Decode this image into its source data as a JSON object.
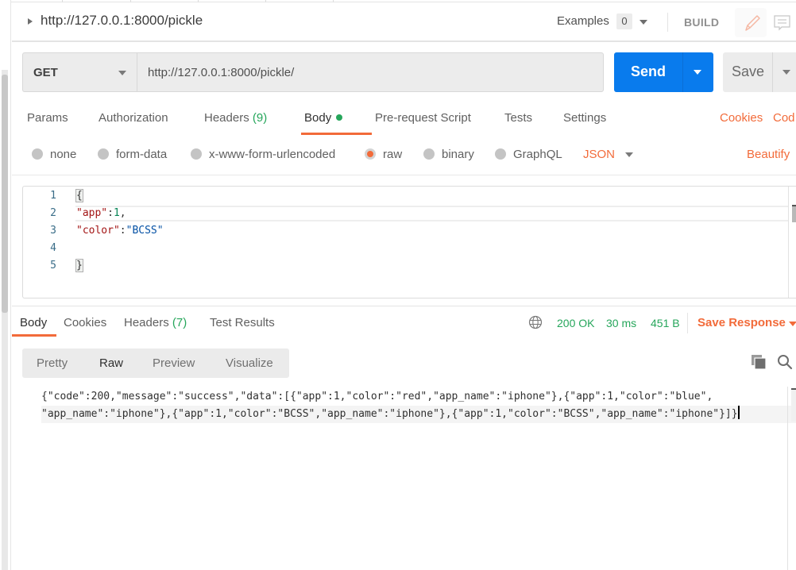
{
  "header": {
    "request_name": "http://127.0.0.1:8000/pickle",
    "examples_label": "Examples",
    "examples_count": "0",
    "build_label": "BUILD"
  },
  "url_bar": {
    "method": "GET",
    "url": "http://127.0.0.1:8000/pickle/",
    "send_label": "Send",
    "save_label": "Save"
  },
  "request_tabs": {
    "items": [
      {
        "label": "Params"
      },
      {
        "label": "Authorization"
      },
      {
        "label": "Headers",
        "count": "(9)"
      },
      {
        "label": "Body",
        "active": true,
        "indicator": "modified-dot"
      },
      {
        "label": "Pre-request Script"
      },
      {
        "label": "Tests"
      },
      {
        "label": "Settings"
      }
    ],
    "cookies_link": "Cookies",
    "code_link": "Cod"
  },
  "body_types": {
    "options": [
      {
        "label": "none"
      },
      {
        "label": "form-data"
      },
      {
        "label": "x-www-form-urlencoded"
      },
      {
        "label": "raw",
        "selected": true
      },
      {
        "label": "binary"
      },
      {
        "label": "GraphQL"
      }
    ],
    "format": "JSON",
    "beautify_label": "Beautify"
  },
  "request_body": {
    "lines": [
      {
        "n": "1",
        "tokens": [
          {
            "t": "{",
            "k": "brace"
          }
        ]
      },
      {
        "n": "2",
        "tokens": [
          {
            "t": "\"app\"",
            "k": "key"
          },
          {
            "t": ":",
            "k": "punc"
          },
          {
            "t": "1",
            "k": "num"
          },
          {
            "t": ",",
            "k": "punc"
          }
        ]
      },
      {
        "n": "3",
        "tokens": [
          {
            "t": "\"color\"",
            "k": "key"
          },
          {
            "t": ":",
            "k": "punc"
          },
          {
            "t": "\"BCSS\"",
            "k": "str"
          }
        ]
      },
      {
        "n": "4",
        "tokens": []
      },
      {
        "n": "5",
        "tokens": [
          {
            "t": "}",
            "k": "brace"
          }
        ]
      }
    ]
  },
  "response_tabs": {
    "items": [
      {
        "label": "Body",
        "active": true
      },
      {
        "label": "Cookies"
      },
      {
        "label": "Headers",
        "count": "(7)"
      },
      {
        "label": "Test Results"
      }
    ],
    "status": "200 OK",
    "time": "30 ms",
    "size": "451 B",
    "save_response_label": "Save Response"
  },
  "format_tabs": {
    "items": [
      {
        "label": "Pretty"
      },
      {
        "label": "Raw",
        "active": true
      },
      {
        "label": "Preview"
      },
      {
        "label": "Visualize"
      }
    ]
  },
  "response_body": {
    "line1": "{\"code\":200,\"message\":\"success\",\"data\":[{\"app\":1,\"color\":\"red\",\"app_name\":\"iphone\"},{\"app\":1,\"color\":\"blue\",",
    "line2": "\"app_name\":\"iphone\"},{\"app\":1,\"color\":\"BCSS\",\"app_name\":\"iphone\"},{\"app\":1,\"color\":\"BCSS\",\"app_name\":\"iphone\"}]}"
  },
  "colors": {
    "accent": "#f26b3a",
    "send": "#097bed",
    "success": "#26a65b"
  }
}
